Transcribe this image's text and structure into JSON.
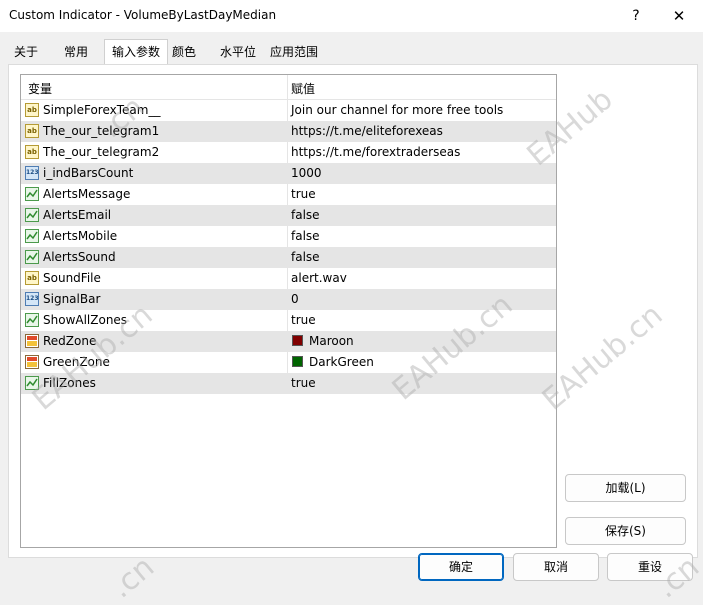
{
  "window": {
    "title": "Custom Indicator - VolumeByLastDayMedian",
    "help_glyph": "?",
    "close_glyph": "✕"
  },
  "tabs": [
    "关于",
    "常用",
    "输入参数",
    "颜色",
    "水平位",
    "应用范围"
  ],
  "active_tab": "输入参数",
  "table": {
    "headers": [
      "变量",
      "赋值"
    ],
    "rows": [
      {
        "icon": "ab",
        "name": "SimpleForexTeam__",
        "value": "Join our channel for more free tools"
      },
      {
        "icon": "ab",
        "name": "The_our_telegram1",
        "value": "https://t.me/eliteforexeas"
      },
      {
        "icon": "ab",
        "name": "The_our_telegram2",
        "value": "https://t.me/forextraderseas"
      },
      {
        "icon": "num",
        "name": "i_indBarsCount",
        "value": "1000"
      },
      {
        "icon": "bool",
        "name": "AlertsMessage",
        "value": "true"
      },
      {
        "icon": "bool",
        "name": "AlertsEmail",
        "value": "false"
      },
      {
        "icon": "bool",
        "name": "AlertsMobile",
        "value": "false"
      },
      {
        "icon": "bool",
        "name": "AlertsSound",
        "value": "false"
      },
      {
        "icon": "ab",
        "name": "SoundFile",
        "value": "alert.wav"
      },
      {
        "icon": "num",
        "name": "SignalBar",
        "value": "0"
      },
      {
        "icon": "bool",
        "name": "ShowAllZones",
        "value": "true"
      },
      {
        "icon": "color",
        "name": "RedZone",
        "value": "Maroon",
        "swatch": "#800000"
      },
      {
        "icon": "color",
        "name": "GreenZone",
        "value": "DarkGreen",
        "swatch": "#006400"
      },
      {
        "icon": "bool",
        "name": "FillZones",
        "value": "true"
      }
    ]
  },
  "icon_glyphs": {
    "ab": "ab",
    "num": "123"
  },
  "buttons": {
    "load": "加载(L)",
    "save": "保存(S)",
    "ok": "确定",
    "cancel": "取消",
    "reset": "重设"
  },
  "watermark": {
    "text_a": "EAHub",
    "text_b": ".cn"
  }
}
